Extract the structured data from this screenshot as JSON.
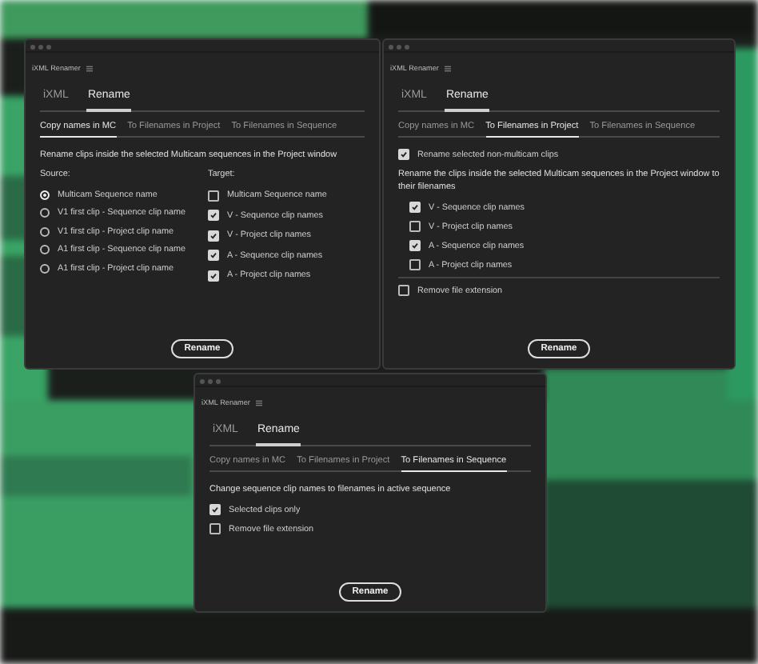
{
  "windows": [
    {
      "title": "iXML Renamer",
      "tabs": [
        {
          "label": "iXML",
          "selected": false
        },
        {
          "label": "Rename",
          "selected": true
        }
      ],
      "subtabs": [
        {
          "label": "Copy names in MC",
          "selected": true
        },
        {
          "label": "To Filenames in Project",
          "selected": false
        },
        {
          "label": "To Filenames in Sequence",
          "selected": false
        }
      ],
      "content": [
        {
          "kind": "text",
          "text": "Rename clips inside the selected Multicam sequences in the Project window"
        },
        {
          "kind": "columns",
          "columns": [
            {
              "heading": "Source:",
              "options": [
                {
                  "kind": "radio",
                  "label": "Multicam Sequence name",
                  "selected": true
                },
                {
                  "kind": "radio",
                  "label": "V1 first clip - Sequence clip name",
                  "selected": false
                },
                {
                  "kind": "radio",
                  "label": "V1 first clip - Project clip name",
                  "selected": false
                },
                {
                  "kind": "radio",
                  "label": "A1 first clip - Sequence clip name",
                  "selected": false
                },
                {
                  "kind": "radio",
                  "label": "A1 first clip - Project clip name",
                  "selected": false
                }
              ]
            },
            {
              "heading": "Target:",
              "options": [
                {
                  "kind": "checkbox",
                  "label": "Multicam Sequence name",
                  "checked": false
                },
                {
                  "kind": "checkbox",
                  "label": "V - Sequence clip names",
                  "checked": true
                },
                {
                  "kind": "checkbox",
                  "label": "V - Project clip names",
                  "checked": true
                },
                {
                  "kind": "checkbox",
                  "label": "A - Sequence clip names",
                  "checked": true
                },
                {
                  "kind": "checkbox",
                  "label": "A - Project clip names",
                  "checked": true
                }
              ]
            }
          ]
        }
      ],
      "button": "Rename"
    },
    {
      "title": "iXML Renamer",
      "tabs": [
        {
          "label": "iXML",
          "selected": false
        },
        {
          "label": "Rename",
          "selected": true
        }
      ],
      "subtabs": [
        {
          "label": "Copy names in MC",
          "selected": false
        },
        {
          "label": "To Filenames in Project",
          "selected": true
        },
        {
          "label": "To Filenames in Sequence",
          "selected": false
        }
      ],
      "content": [
        {
          "kind": "checkbox",
          "label": "Rename selected non-multicam clips",
          "checked": true
        },
        {
          "kind": "text",
          "text": "Rename the clips inside the selected Multicam sequences in the Project window to their filenames"
        },
        {
          "kind": "group",
          "options": [
            {
              "kind": "checkbox",
              "label": "V - Sequence clip names",
              "checked": true
            },
            {
              "kind": "checkbox",
              "label": "V - Project clip names",
              "checked": false
            },
            {
              "kind": "checkbox",
              "label": "A - Sequence clip names",
              "checked": true
            },
            {
              "kind": "checkbox",
              "label": "A - Project clip names",
              "checked": false
            }
          ]
        },
        {
          "kind": "divider"
        },
        {
          "kind": "checkbox",
          "label": "Remove file extension",
          "checked": false
        }
      ],
      "button": "Rename"
    },
    {
      "title": "iXML Renamer",
      "tabs": [
        {
          "label": "iXML",
          "selected": false
        },
        {
          "label": "Rename",
          "selected": true
        }
      ],
      "subtabs": [
        {
          "label": "Copy names in MC",
          "selected": false
        },
        {
          "label": "To Filenames in Project",
          "selected": false
        },
        {
          "label": "To Filenames in Sequence",
          "selected": true
        }
      ],
      "content": [
        {
          "kind": "text",
          "text": "Change sequence clip names to filenames in active sequence"
        },
        {
          "kind": "checkbox",
          "label": "Selected clips only",
          "checked": true
        },
        {
          "kind": "checkbox",
          "label": "Remove file extension",
          "checked": false
        }
      ],
      "button": "Rename"
    }
  ]
}
